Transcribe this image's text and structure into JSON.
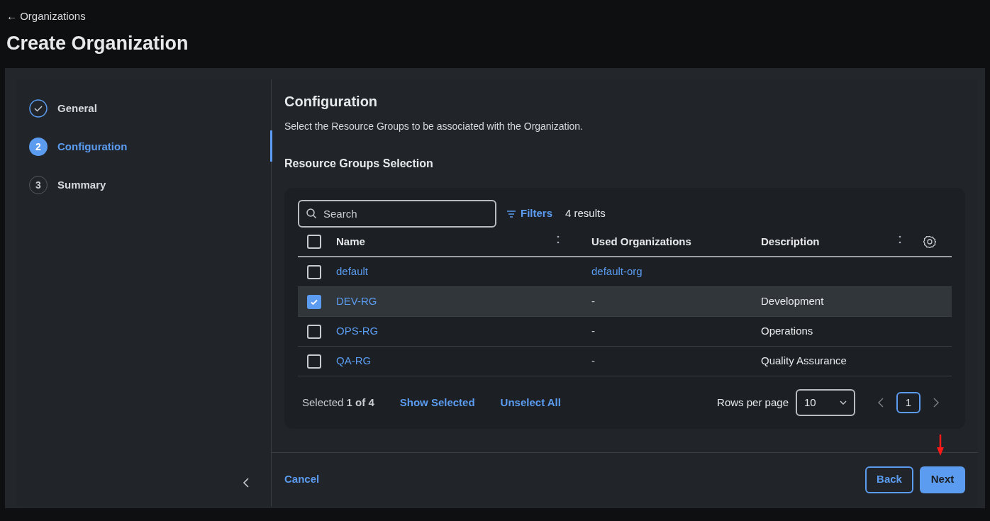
{
  "breadcrumb": "← Organizations",
  "title": "Create Organization",
  "steps": [
    {
      "label": "General",
      "completed": true,
      "selected": false
    },
    {
      "marker": "2",
      "label": "Configuration",
      "completed": false,
      "selected": true
    },
    {
      "marker": "3",
      "label": "Summary",
      "completed": false,
      "selected": false
    }
  ],
  "section": {
    "title": "Configuration",
    "subtitle": "Select the Resource Groups to be associated with the Organization.",
    "heading": "Resource Groups Selection"
  },
  "toolbar": {
    "search_placeholder": "Search",
    "filters": "Filters",
    "results": "4 results"
  },
  "table": {
    "all_checked": false,
    "columns": [
      "Name",
      "Used Organizations",
      "Description"
    ],
    "rows": [
      {
        "name": "default",
        "used": "default-org",
        "used_link": true,
        "selected": false
      },
      {
        "name": "DEV-RG",
        "used": "-",
        "used_link": false,
        "description": "Development",
        "selected": true
      },
      {
        "name": "OPS-RG",
        "used": "-",
        "used_link": false,
        "description": "Operations",
        "selected": false
      },
      {
        "name": "QA-RG",
        "used": "-",
        "used_link": false,
        "description": "Quality Assurance",
        "selected": false
      }
    ]
  },
  "footer": {
    "selected": "Selected **1 of 4**",
    "show_selected": "Show Selected",
    "unselect_all": "Unselect All",
    "rows_per_page": "Rows per page",
    "rows_value": "10",
    "page": "1"
  },
  "actions": {
    "cancel": "Cancel",
    "back": "Back",
    "next": "Next"
  }
}
